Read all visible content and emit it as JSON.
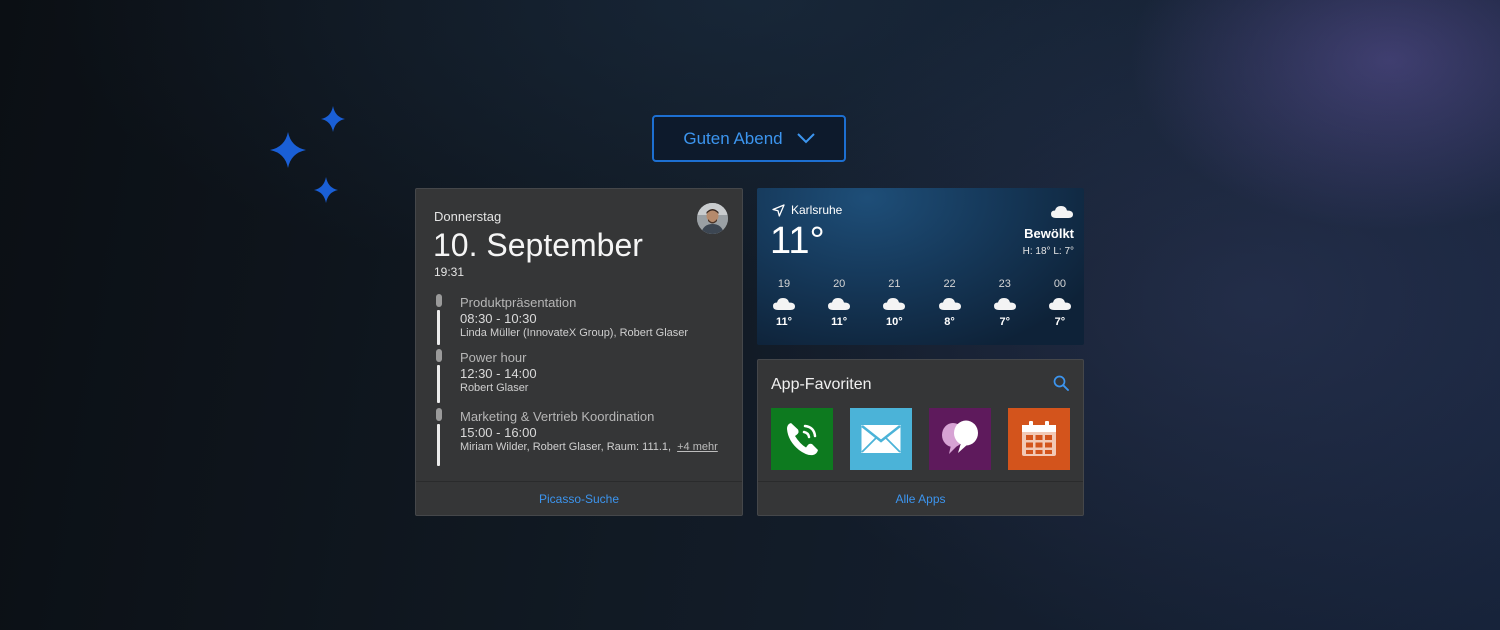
{
  "greeting": {
    "label": "Guten Abend"
  },
  "calendar": {
    "weekday": "Donnerstag",
    "date": "10. September",
    "time": "19:31",
    "events": [
      {
        "title": "Produktpräsentation",
        "time": "08:30 - 10:30",
        "people": "Linda Müller (InnovateX Group), Robert Glaser"
      },
      {
        "title": "Power hour",
        "time": "12:30 - 14:00",
        "people": "Robert Glaser"
      },
      {
        "title": "Marketing & Vertrieb Koordination",
        "time": "15:00 - 16:00",
        "people": "Miriam Wilder, Robert Glaser, Raum: 111.1,",
        "more": "+4 mehr"
      }
    ],
    "footer": "Picasso-Suche"
  },
  "weather": {
    "location": "Karlsruhe",
    "temperature": "11°",
    "condition": "Bewölkt",
    "high_low": "H: 18° L: 7°",
    "hourly": [
      {
        "hour": "19",
        "temp": "11°",
        "icon": "cloud-icon"
      },
      {
        "hour": "20",
        "temp": "11°",
        "icon": "cloud-icon"
      },
      {
        "hour": "21",
        "temp": "10°",
        "icon": "cloud-icon"
      },
      {
        "hour": "22",
        "temp": "8°",
        "icon": "cloud-icon"
      },
      {
        "hour": "23",
        "temp": "7°",
        "icon": "cloud-icon"
      },
      {
        "hour": "00",
        "temp": "7°",
        "icon": "cloud-icon"
      }
    ]
  },
  "apps": {
    "title": "App-Favoriten",
    "footer": "Alle Apps",
    "tiles": [
      {
        "icon": "phone-icon",
        "color": "#0d7a1f"
      },
      {
        "icon": "mail-icon",
        "color": "#4bb3d8"
      },
      {
        "icon": "chat-bubbles-icon",
        "color": "#5e1a5c"
      },
      {
        "icon": "calendar-icon",
        "color": "#d3541c"
      }
    ]
  },
  "colors": {
    "accent": "#3c95ef",
    "card": "#353637"
  }
}
